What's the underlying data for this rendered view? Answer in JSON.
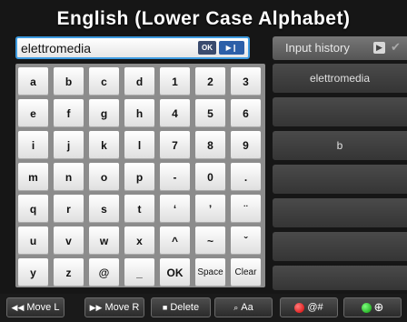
{
  "title": "English (Lower Case Alphabet)",
  "input": {
    "value": "elettromedia",
    "ok_label": "OK",
    "play_label": "▶❙"
  },
  "history": {
    "header_label": "Input history",
    "play_icon": "▶",
    "check_icon": "✔",
    "items": [
      "elettromedia",
      "",
      "b",
      "",
      "",
      "",
      ""
    ]
  },
  "keyboard": {
    "rows": [
      [
        "a",
        "b",
        "c",
        "d",
        "1",
        "2",
        "3"
      ],
      [
        "e",
        "f",
        "g",
        "h",
        "4",
        "5",
        "6"
      ],
      [
        "i",
        "j",
        "k",
        "l",
        "7",
        "8",
        "9"
      ],
      [
        "m",
        "n",
        "o",
        "p",
        "-",
        "0",
        "."
      ],
      [
        "q",
        "r",
        "s",
        "t",
        "‘",
        "’",
        "¨"
      ],
      [
        "u",
        "v",
        "w",
        "x",
        "^",
        "~",
        "ˇ"
      ],
      [
        "y",
        "z",
        "@",
        "_",
        "OK",
        "Space",
        "Clear"
      ]
    ]
  },
  "bottom_bar": {
    "move_left": "Move L",
    "move_right": "Move R",
    "delete": "Delete",
    "case": "Aa",
    "symbols": "@#",
    "globe_icon": "⊕",
    "colors": {
      "red": "#d40000",
      "green": "#0a9a0a"
    }
  }
}
